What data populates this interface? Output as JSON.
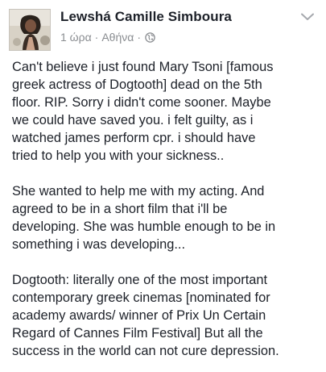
{
  "post": {
    "author": "Lewshá Camille Simboura",
    "time": "1 ώρα",
    "separator": "·",
    "location": "Αθήνα",
    "separator2": "·",
    "privacy_icon": "globe-icon",
    "menu_icon": "chevron-down-icon",
    "paragraphs": [
      "Can't believe i just found Mary Tsoni [famous\ngreek actress of Dogtooth] dead on the 5th\nfloor. RIP. Sorry i didn't come sooner. Maybe\nwe could have saved you. i felt guilty, as i\nwatched james perform cpr. i should have\ntried to help you with your sickness..",
      "She wanted to help me with my acting. And\nagreed to be in a short film that i'll be\ndeveloping. She was humble enough to be in\nsomething i was developing...",
      "Dogtooth: literally one of the most important\ncontemporary greek cinemas [nominated for\nacademy awards/ winner of Prix Un Certain\nRegard  of Cannes Film Festival] But all the\nsuccess in the world can not cure depression."
    ]
  },
  "colors": {
    "text": "#1d2129",
    "meta": "#8a8d91",
    "background": "#ffffff"
  }
}
